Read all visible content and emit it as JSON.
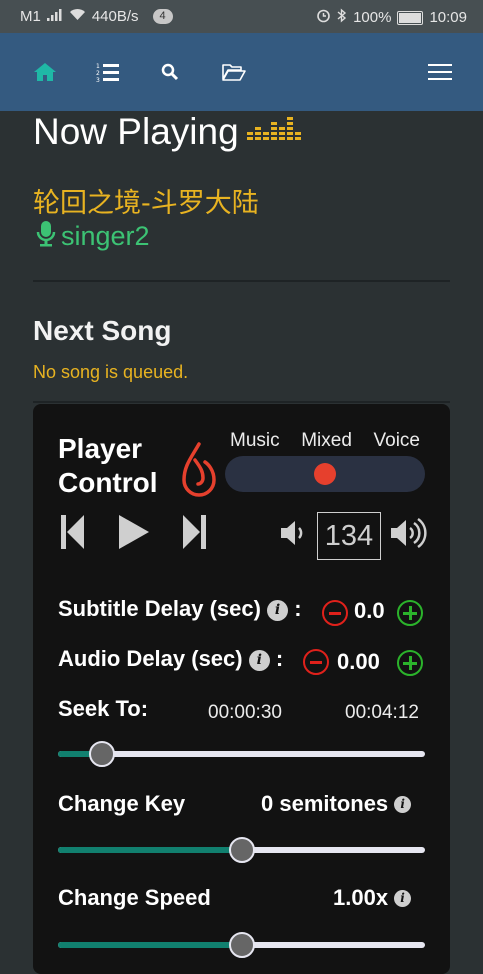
{
  "status_bar": {
    "carrier": "M1",
    "net_speed": "440B/s",
    "notif_count": "4",
    "battery": "100%",
    "time": "10:09"
  },
  "nav": {
    "icons": [
      "home-icon",
      "queue-icon",
      "search-icon",
      "folder-icon",
      "menu-icon"
    ]
  },
  "now_playing": {
    "title": "Now Playing",
    "song": "轮回之境-斗罗大陆",
    "singer": "singer2"
  },
  "next_song": {
    "title": "Next Song",
    "message": "No song is queued."
  },
  "player": {
    "title": "Player Control",
    "modes": [
      "Music",
      "Mixed",
      "Voice"
    ],
    "mode_value": 0.5,
    "volume": "134",
    "subtitle_delay_label": "Subtitle Delay (sec)",
    "subtitle_delay_value": "0.0",
    "audio_delay_label": "Audio Delay (sec)",
    "audio_delay_value": "0.00",
    "seek_label": "Seek To:",
    "seek_current": "00:00:30",
    "seek_total": "00:04:12",
    "seek_fraction": 0.12,
    "key_label": "Change Key",
    "key_value": "0 semitones",
    "key_fraction": 0.5,
    "speed_label": "Change Speed",
    "speed_value": "1.00x",
    "speed_fraction": 0.5
  },
  "colors": {
    "accent_gold": "#e8b321",
    "singer_green": "#3cc374",
    "navbar": "#345a80",
    "minus_red": "#e0211b",
    "plus_green": "#2bb32b",
    "slider_fill": "#11806f"
  }
}
